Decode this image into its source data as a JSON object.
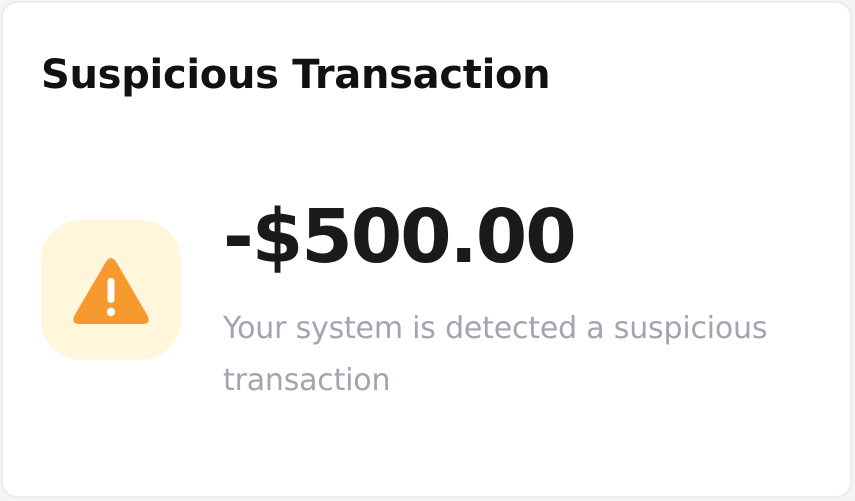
{
  "card": {
    "title": "Suspicious Transaction",
    "amount": "-$500.00",
    "description": "Your system is detected a suspicious transaction",
    "icon": "warning-triangle-icon"
  },
  "colors": {
    "icon_fill": "#f79a2e",
    "icon_badge_bg": "#fff6dc",
    "title": "#111111",
    "amount": "#1a1a1a",
    "description": "#a3a4b1"
  }
}
